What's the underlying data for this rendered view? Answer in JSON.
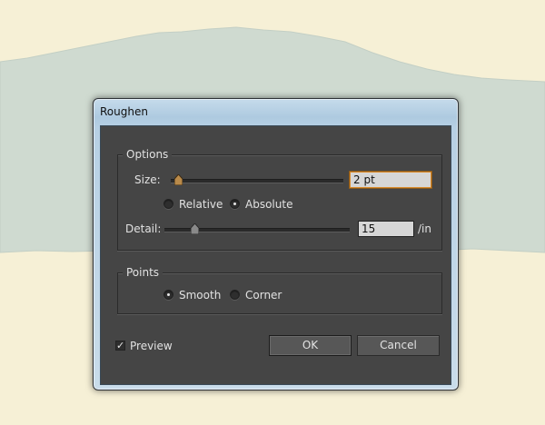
{
  "dialog": {
    "title": "Roughen",
    "options_group": {
      "legend": "Options",
      "size_label": "Size:",
      "size_value": "2 pt",
      "size_slider_fraction": 0.02,
      "mode_relative": "Relative",
      "mode_absolute": "Absolute",
      "mode_selected": "Absolute",
      "detail_label": "Detail:",
      "detail_value": "15",
      "detail_unit": "/in",
      "detail_slider_fraction": 0.15
    },
    "points_group": {
      "legend": "Points",
      "smooth_label": "Smooth",
      "corner_label": "Corner",
      "selected": "Smooth"
    },
    "preview_label": "Preview",
    "preview_checked": true,
    "ok_label": "OK",
    "cancel_label": "Cancel"
  },
  "colors": {
    "background": "#f6f0d6",
    "shape": "#cfdad0",
    "panel": "#454545",
    "focus_border": "#d98a2b"
  }
}
